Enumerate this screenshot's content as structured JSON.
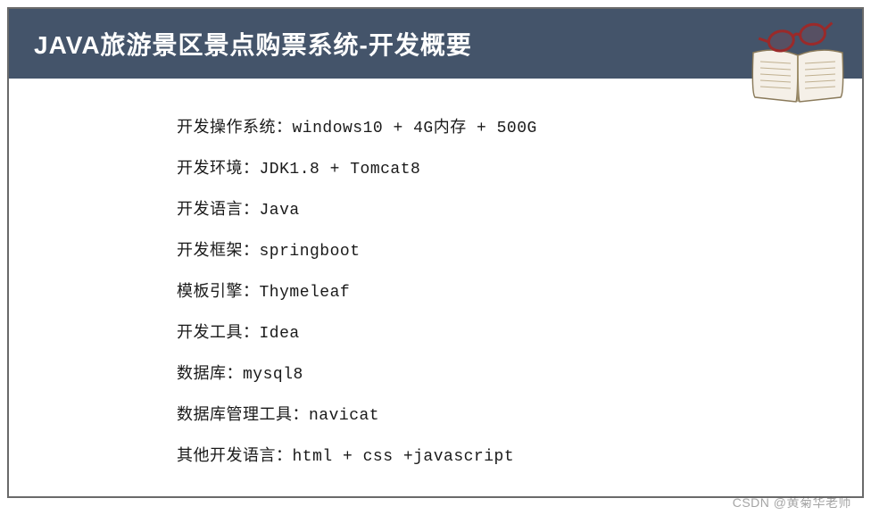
{
  "header": {
    "title": "JAVA旅游景区景点购票系统-开发概要"
  },
  "content": {
    "lines": [
      "开发操作系统：windows10 + 4G内存 + 500G",
      "开发环境：JDK1.8 + Tomcat8",
      "开发语言：Java",
      "开发框架：springboot",
      "模板引擎：Thymeleaf",
      "开发工具：Idea",
      "数据库：mysql8",
      "数据库管理工具：navicat",
      "其他开发语言：html + css +javascript"
    ]
  },
  "watermark": "CSDN @黄菊华老师",
  "icon": {
    "name": "book-with-glasses-icon"
  }
}
